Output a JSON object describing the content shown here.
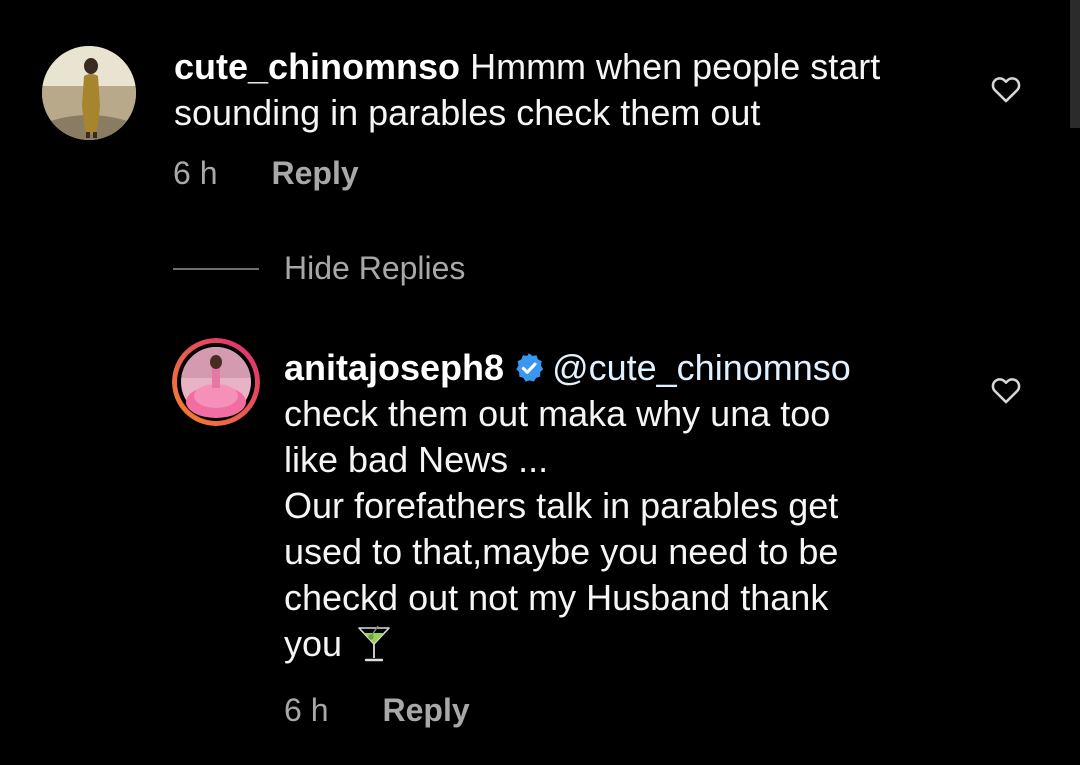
{
  "comments": [
    {
      "username": "cute_chinomnso",
      "lines": [
        "Hmmm when people start",
        "sounding in parables  check them out"
      ],
      "timestamp": "6 h",
      "reply_label": "Reply"
    }
  ],
  "replies_toggle": {
    "label": "Hide Replies"
  },
  "replies": [
    {
      "username": "anitajoseph8",
      "verified": true,
      "mention": "@cute_chinomnso",
      "lines": [
        "check them out maka why una too",
        "like bad News ...",
        "Our forefathers talk in parables get",
        "used to that,maybe you need to be",
        "checkd out not my Husband thank",
        "you"
      ],
      "emoji": "cocktail-glass-emoji",
      "timestamp": "6 h",
      "reply_label": "Reply"
    }
  ],
  "icons": {
    "like": "heart-outline-icon",
    "verified": "verified-badge-icon"
  },
  "colors": {
    "background": "#000000",
    "text_primary": "#ffffff",
    "text_secondary": "#a8a8a8",
    "verified_blue": "#3897f0",
    "story_ring_start": "#f58529",
    "story_ring_end": "#dd2a7b"
  }
}
